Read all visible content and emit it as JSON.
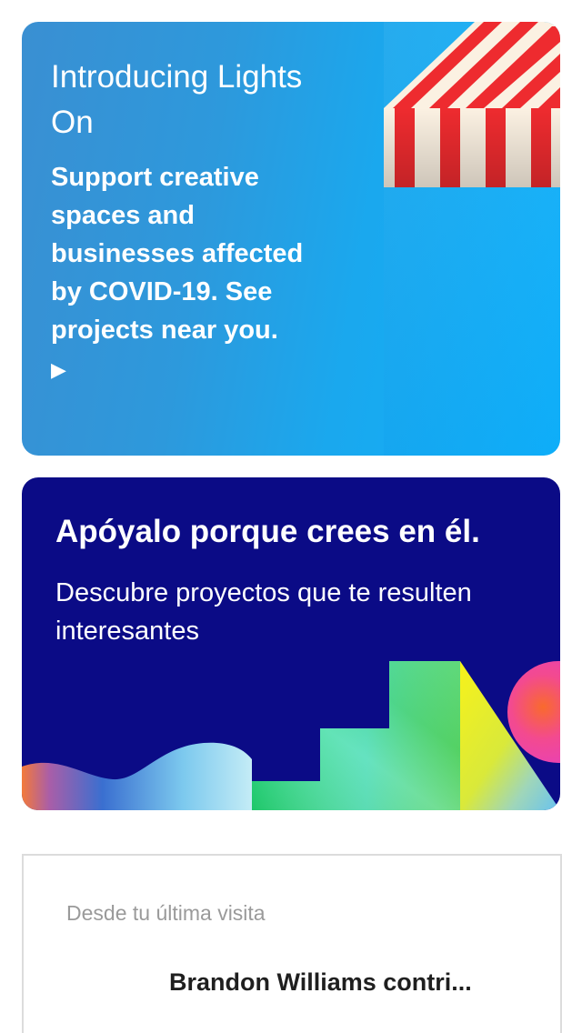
{
  "lights_on_card": {
    "title": "Introducing Lights On",
    "subtitle": "Support creative spaces and businesses affected by COVID-19. See projects near you.",
    "play_glyph": "▶",
    "icon": "play-icon",
    "awning_colors": [
      "#ee2b2f",
      "#fbf1e2"
    ],
    "background_color": "#2d99dc"
  },
  "support_card": {
    "title": "Apóyalo porque crees en él.",
    "description": "Descubre proyectos que te resulten interesantes",
    "background_color": "#0b0b86"
  },
  "activity_card": {
    "section_label": "Desde tu última visita",
    "items": [
      {
        "text": "Brandon Williams contri..."
      }
    ]
  }
}
